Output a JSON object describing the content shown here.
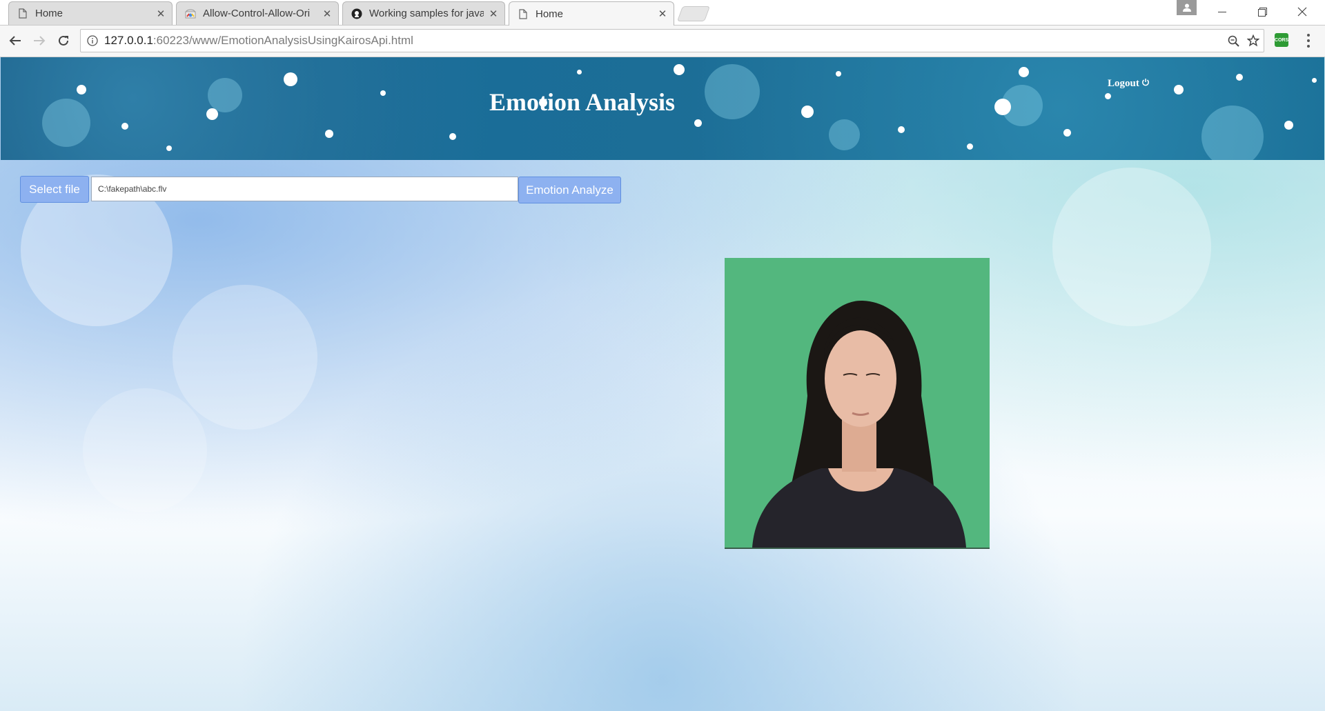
{
  "browser": {
    "tabs": [
      {
        "title": "Home",
        "icon": "page-icon",
        "active": false
      },
      {
        "title": "Allow-Control-Allow-Ori",
        "icon": "chrome-webstore-icon",
        "active": false
      },
      {
        "title": "Working samples for java",
        "icon": "github-icon",
        "active": false
      },
      {
        "title": "Home",
        "icon": "page-icon",
        "active": true
      }
    ],
    "address": {
      "host": "127.0.0.1",
      "path": ":60223/www/EmotionAnalysisUsingKairosApi.html"
    },
    "extension_label": "CORS"
  },
  "page": {
    "title": "Emotion Analysis",
    "logout_label": "Logout",
    "select_file_label": "Select file",
    "file_path_value": "C:\\fakepath\\abc.flv",
    "analyze_label": "Emotion Analyze",
    "accent_color": "#8db1f0",
    "banner_color": "#1a6d98"
  }
}
